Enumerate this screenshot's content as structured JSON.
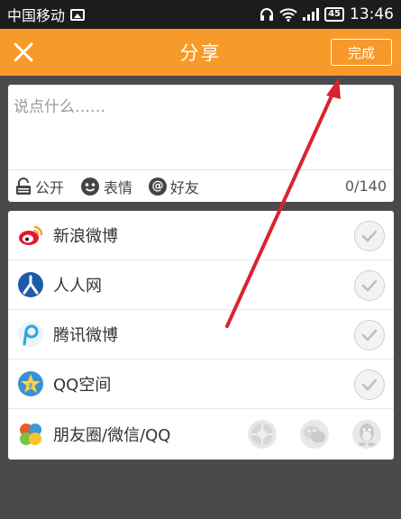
{
  "status_bar": {
    "carrier": "中国移动",
    "battery": "45",
    "time": "13:46"
  },
  "header": {
    "title": "分享",
    "done_label": "完成"
  },
  "compose": {
    "placeholder": "说点什么……",
    "public_label": "公开",
    "emoji_label": "表情",
    "friends_label": "好友",
    "char_count": "0/140"
  },
  "share": {
    "items": [
      {
        "label": "新浪微博",
        "icon": "sina-weibo-icon"
      },
      {
        "label": "人人网",
        "icon": "renren-icon"
      },
      {
        "label": "腾讯微博",
        "icon": "tencent-weibo-icon"
      },
      {
        "label": "QQ空间",
        "icon": "qzone-icon"
      },
      {
        "label": "朋友圈/微信/QQ",
        "icon": "moments-icon"
      }
    ]
  },
  "colors": {
    "accent": "#f79a2a",
    "status_bar": "#1c1c1c",
    "background": "#4a4a4a",
    "arrow": "#d9232e"
  }
}
